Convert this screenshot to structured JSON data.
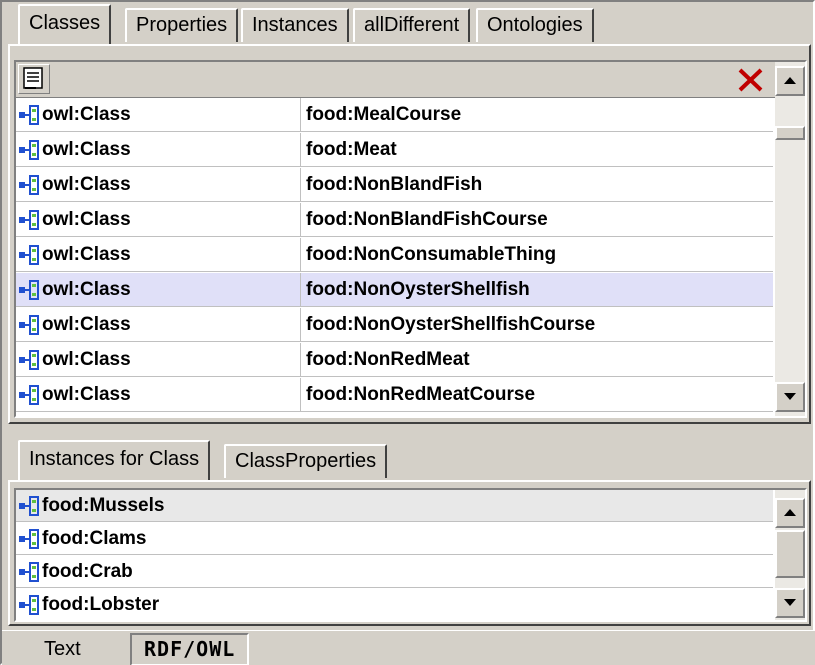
{
  "top_tabs": [
    {
      "label": "Classes",
      "active": true
    },
    {
      "label": "Properties",
      "active": false
    },
    {
      "label": "Instances",
      "active": false
    },
    {
      "label": "allDifferent",
      "active": false
    },
    {
      "label": "Ontologies",
      "active": false
    }
  ],
  "toolbar": {
    "list_icon": "list-icon",
    "delete_icon": "delete-x-icon",
    "delete_color": "#c00000"
  },
  "classes": [
    {
      "type": "owl:Class",
      "name": "food:MealCourse",
      "selected": false
    },
    {
      "type": "owl:Class",
      "name": "food:Meat",
      "selected": false
    },
    {
      "type": "owl:Class",
      "name": "food:NonBlandFish",
      "selected": false
    },
    {
      "type": "owl:Class",
      "name": "food:NonBlandFishCourse",
      "selected": false
    },
    {
      "type": "owl:Class",
      "name": "food:NonConsumableThing",
      "selected": false
    },
    {
      "type": "owl:Class",
      "name": "food:NonOysterShellfish",
      "selected": true
    },
    {
      "type": "owl:Class",
      "name": "food:NonOysterShellfishCourse",
      "selected": false
    },
    {
      "type": "owl:Class",
      "name": "food:NonRedMeat",
      "selected": false
    },
    {
      "type": "owl:Class",
      "name": "food:NonRedMeatCourse",
      "selected": false
    }
  ],
  "bottom_tabs": [
    {
      "label": "Instances for Class",
      "active": true
    },
    {
      "label": "ClassProperties",
      "active": false
    }
  ],
  "instances": [
    {
      "name": "food:Mussels",
      "highlighted": true
    },
    {
      "name": "food:Clams",
      "highlighted": false
    },
    {
      "name": "food:Crab",
      "highlighted": false
    },
    {
      "name": "food:Lobster",
      "highlighted": false
    }
  ],
  "status_tabs": [
    {
      "label": "Text",
      "active": false
    },
    {
      "label": "RDF/OWL",
      "active": true
    }
  ],
  "row_icon": "owl-class-node-icon",
  "icon_color": "#2050d0"
}
